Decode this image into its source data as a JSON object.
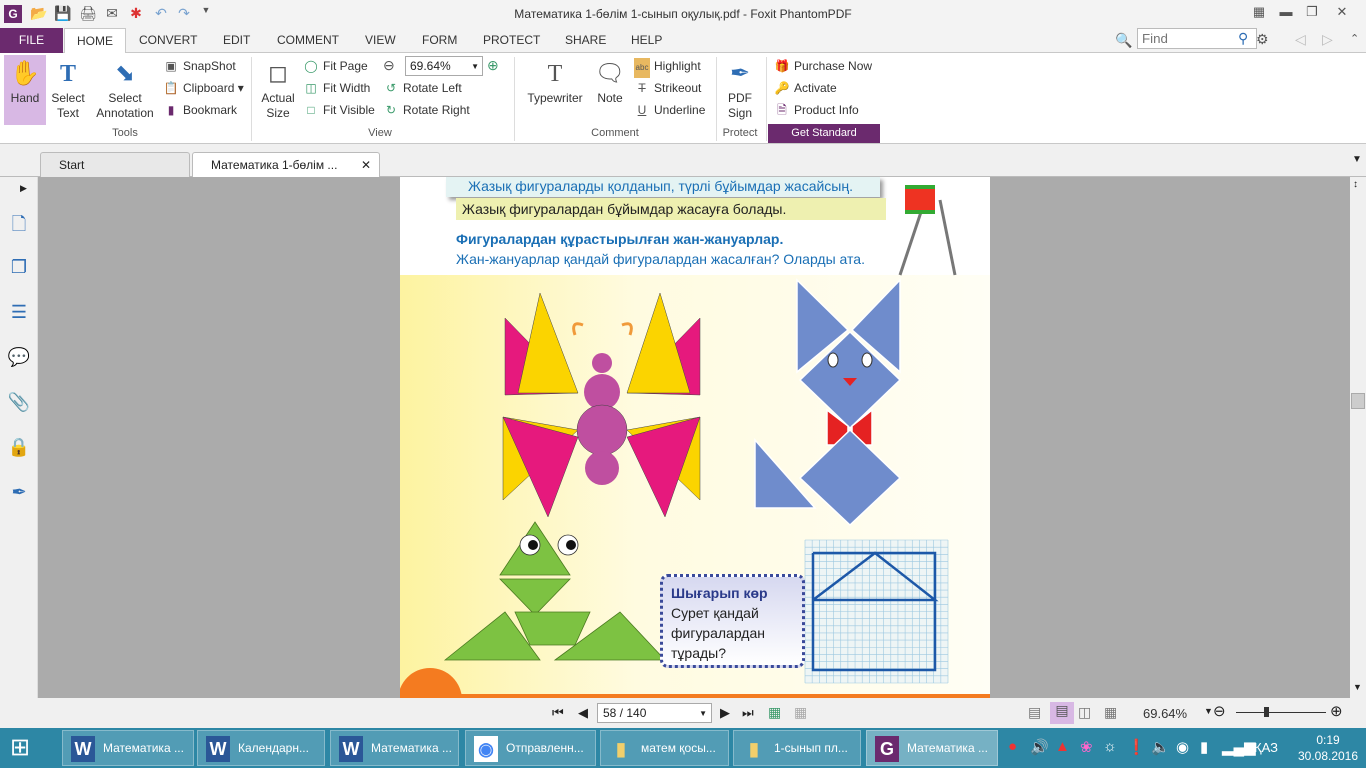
{
  "window": {
    "title": "Математика 1-бөлім 1-сынып оқулық.pdf - Foxit PhantomPDF"
  },
  "menu": {
    "tabs": [
      "FILE",
      "HOME",
      "CONVERT",
      "EDIT",
      "COMMENT",
      "VIEW",
      "FORM",
      "PROTECT",
      "SHARE",
      "HELP"
    ],
    "active": "HOME",
    "find_placeholder": "Find"
  },
  "ribbon": {
    "tools": {
      "label": "Tools",
      "hand": "Hand",
      "select_text": "Select Text",
      "select_annotation": "Select Annotation",
      "snapshot": "SnapShot",
      "clipboard": "Clipboard",
      "bookmark": "Bookmark"
    },
    "view": {
      "label": "View",
      "actual_size": "Actual Size",
      "fit_page": "Fit Page",
      "fit_width": "Fit Width",
      "fit_visible": "Fit Visible",
      "zoom": "69.64%",
      "rotate_left": "Rotate Left",
      "rotate_right": "Rotate Right"
    },
    "comment": {
      "label": "Comment",
      "typewriter": "Typewriter",
      "note": "Note",
      "highlight": "Highlight",
      "strikeout": "Strikeout",
      "underline": "Underline"
    },
    "protect": {
      "label": "Protect",
      "pdf_sign": "PDF Sign"
    },
    "purchase": {
      "purchase_now": "Purchase Now",
      "activate": "Activate",
      "product_info": "Product Info",
      "get_standard": "Get Standard"
    }
  },
  "doc_tabs": [
    {
      "label": "Start"
    },
    {
      "label": "Математика 1-бөлім ..."
    }
  ],
  "page_content": {
    "objective": "Жазық фигураларды қолданып, түрлі бұйымдар жасайсың.",
    "highlight_text": "Жазық фигуралардан бұйымдар жасауға болады.",
    "heading": "Фигуралардан құрастырылған жан-жануарлар.",
    "question": "Жан-жануарлар қандай фигуралардан жасалған? Оларды ата.",
    "callout_title": "Шығарып көр",
    "callout_lines": [
      "Сурет қандай",
      "фигуралардан",
      "тұрады?"
    ]
  },
  "status": {
    "page": "58 / 140",
    "zoom": "69.64%"
  },
  "taskbar": {
    "items": [
      {
        "label": "Математика ...",
        "icon": "word-icon"
      },
      {
        "label": "Календарн...",
        "icon": "word-icon"
      },
      {
        "label": "Математика ...",
        "icon": "word-icon"
      },
      {
        "label": "Отправленн...",
        "icon": "chrome-icon"
      },
      {
        "label": "матем қосы...",
        "icon": "folder-icon"
      },
      {
        "label": "1-сынып пл...",
        "icon": "folder-icon"
      },
      {
        "label": "Математика ...",
        "icon": "foxit-icon"
      }
    ],
    "language": "ҚАЗ",
    "time": "0:19",
    "date": "30.08.2016"
  },
  "colors": {
    "accent": "#6b2a6e",
    "taskbar": "#2d87a5",
    "heading_blue": "#1a6fb5"
  }
}
